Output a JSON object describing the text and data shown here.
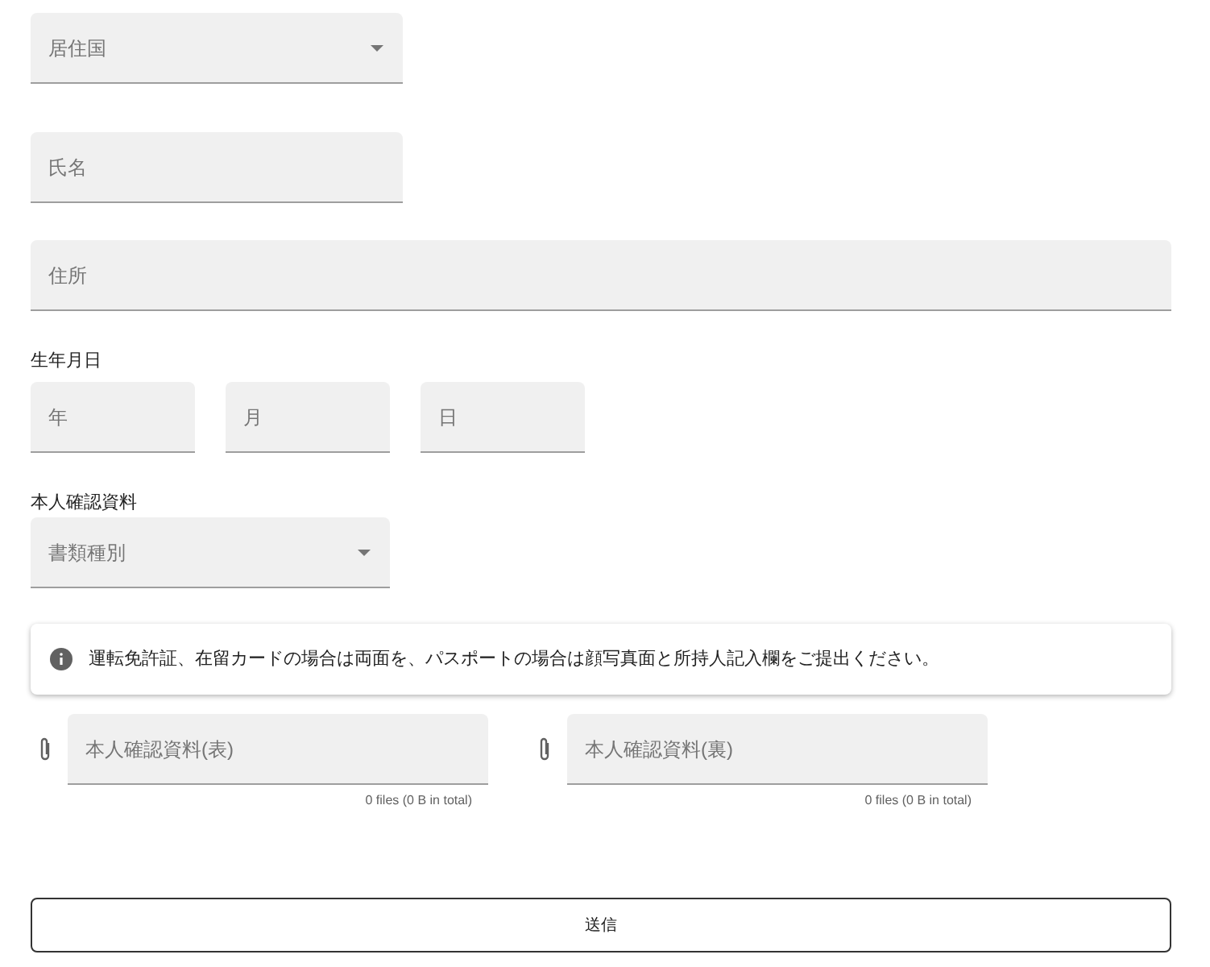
{
  "country_select": {
    "placeholder": "居住国"
  },
  "name_field": {
    "placeholder": "氏名"
  },
  "address_field": {
    "placeholder": "住所"
  },
  "birthdate": {
    "label": "生年月日",
    "fields": [
      {
        "placeholder": "年"
      },
      {
        "placeholder": "月"
      },
      {
        "placeholder": "日"
      }
    ]
  },
  "id_document": {
    "label": "本人確認資料",
    "type_select": {
      "placeholder": "書類種別"
    },
    "notice": "運転免許証、在留カードの場合は両面を、パスポートの場合は顔写真面と所持人記入欄をご提出ください。",
    "uploads": [
      {
        "placeholder": "本人確認資料(表)",
        "hint": "0 files (0 B in total)"
      },
      {
        "placeholder": "本人確認資料(裏)",
        "hint": "0 files (0 B in total)"
      }
    ]
  },
  "submit_button": "送信"
}
